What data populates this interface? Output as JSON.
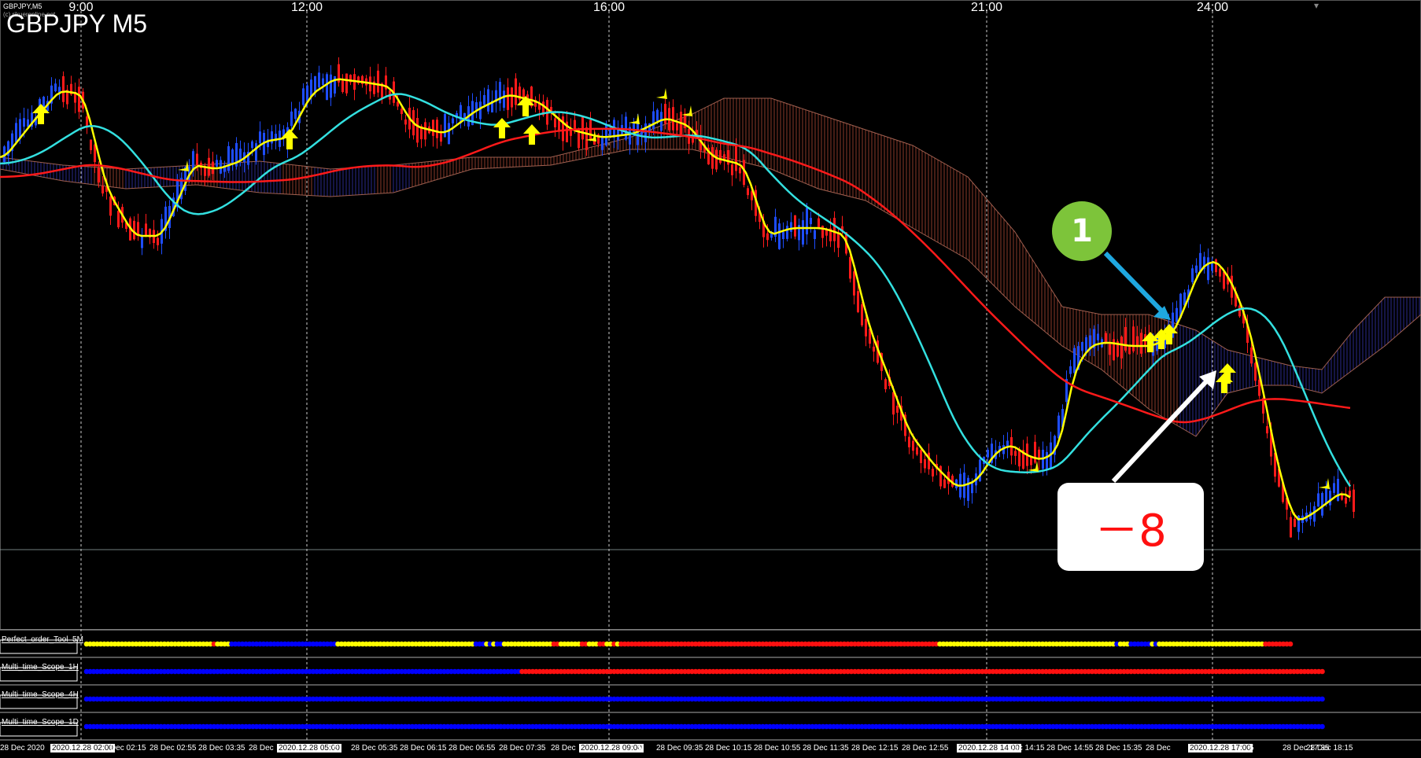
{
  "window": {
    "symbol_line": "GBPJPY,M5",
    "copyright_line": "(c) rikueronline.net",
    "chart_title": "GBPJPY M5"
  },
  "hour_labels": [
    "9:00",
    "12:00",
    "16:00",
    "21:00",
    "24:00"
  ],
  "subwindows": [
    {
      "label": "Perfect_order_Tool_5M"
    },
    {
      "label": "Multi_time_Scope_1H"
    },
    {
      "label": "Multi_time_Scope_4H"
    },
    {
      "label": "Multi_time_Scope_1D"
    }
  ],
  "time_axis": [
    {
      "text": "28 Dec 2020",
      "highlight": false
    },
    {
      "text": "2020.12.28 02:00",
      "highlight": true
    },
    {
      "text": "Dec 02:15",
      "highlight": false
    },
    {
      "text": "28 Dec 02:55",
      "highlight": false
    },
    {
      "text": "28 Dec 03:35",
      "highlight": false
    },
    {
      "text": "28 Dec",
      "highlight": false
    },
    {
      "text": "2020.12.28 05:00",
      "highlight": true
    },
    {
      "text": "5",
      "highlight": false
    },
    {
      "text": "28 Dec 05:35",
      "highlight": false
    },
    {
      "text": "28 Dec 06:15",
      "highlight": false
    },
    {
      "text": "28 Dec 06:55",
      "highlight": false
    },
    {
      "text": "28 Dec 07:35",
      "highlight": false
    },
    {
      "text": "28 Dec",
      "highlight": false
    },
    {
      "text": "2020.12.28 09:00",
      "highlight": true
    },
    {
      "text": "5",
      "highlight": false
    },
    {
      "text": "28 Dec 09:35",
      "highlight": false
    },
    {
      "text": "28 Dec 10:15",
      "highlight": false
    },
    {
      "text": "28 Dec 10:55",
      "highlight": false
    },
    {
      "text": "28 Dec 11:35",
      "highlight": false
    },
    {
      "text": "28 Dec 12:15",
      "highlight": false
    },
    {
      "text": "28 Dec 12:55",
      "highlight": false
    },
    {
      "text": "2020.12.28 14:00",
      "highlight": true
    },
    {
      "text": "Dec 14:15",
      "highlight": false
    },
    {
      "text": "28 Dec 14:55",
      "highlight": false
    },
    {
      "text": "28 Dec 15:35",
      "highlight": false
    },
    {
      "text": "28 Dec",
      "highlight": false
    },
    {
      "text": "2020.12.28 17:00",
      "highlight": true
    },
    {
      "text": "5",
      "highlight": false
    },
    {
      "text": "28 Dec 17:35",
      "highlight": false
    },
    {
      "text": "28 Dec 18:15",
      "highlight": false
    }
  ],
  "annotations": {
    "badge_number": "1",
    "callout_text": "－8"
  },
  "colors": {
    "background": "#000000",
    "bull_candle": "#1e4dff",
    "bear_candle": "#ff1a1a",
    "fast_ma": "#ffff00",
    "mid_ma": "#33e0e0",
    "slow_ma": "#ff1a1a",
    "signal_arrow": "#ffff00",
    "callout_arrow_blue": "#1fa8e0",
    "callout_arrow_white": "#ffffff",
    "badge": "#7dc43a",
    "dot_yellow": "#ffff00",
    "dot_blue": "#0000ff",
    "dot_red": "#ff1010"
  },
  "indicator_rows": [
    {
      "name": "Perfect_order_Tool_5M",
      "runs": [
        [
          "yellow",
          36
        ],
        [
          "red",
          1
        ],
        [
          "yellow",
          4
        ],
        [
          "blue",
          30
        ],
        [
          "yellow",
          39
        ],
        [
          "blue",
          3
        ],
        [
          "yellow",
          1
        ],
        [
          "blue",
          1
        ],
        [
          "yellow",
          1
        ],
        [
          "blue",
          2
        ],
        [
          "yellow",
          14
        ],
        [
          "red",
          2
        ],
        [
          "yellow",
          6
        ],
        [
          "red",
          2
        ],
        [
          "yellow",
          3
        ],
        [
          "red",
          2
        ],
        [
          "yellow",
          2
        ],
        [
          "red",
          1
        ],
        [
          "yellow",
          1
        ],
        [
          "red",
          90
        ],
        [
          "yellow",
          50
        ],
        [
          "blue",
          1
        ],
        [
          "yellow",
          3
        ],
        [
          "blue",
          6
        ],
        [
          "yellow",
          1
        ],
        [
          "blue",
          1
        ],
        [
          "yellow",
          30
        ],
        [
          "red",
          8
        ]
      ]
    },
    {
      "name": "Multi_time_Scope_1H",
      "runs": [
        [
          "blue",
          123
        ],
        [
          "red",
          227
        ]
      ]
    },
    {
      "name": "Multi_time_Scope_4H",
      "runs": [
        [
          "blue",
          350
        ]
      ]
    },
    {
      "name": "Multi_time_Scope_1D",
      "runs": [
        [
          "blue",
          350
        ]
      ]
    }
  ]
}
